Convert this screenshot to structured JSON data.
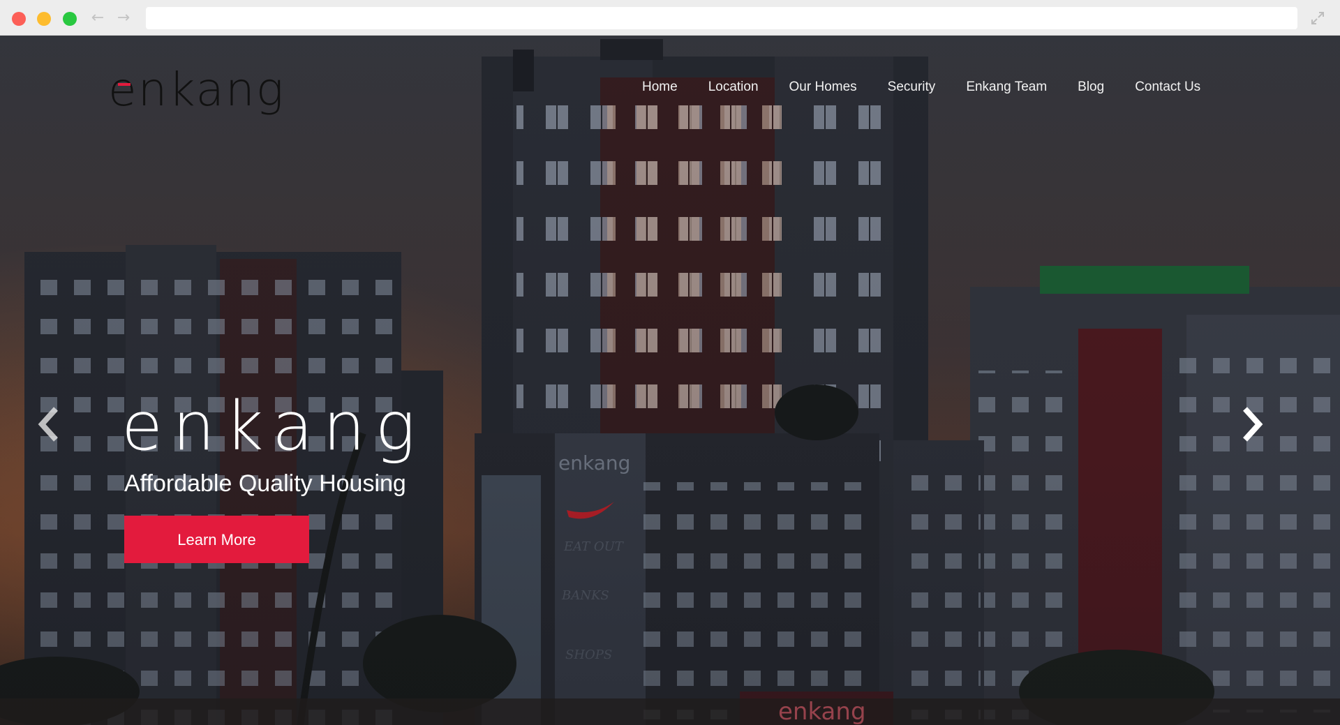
{
  "browser": {
    "controls": [
      "close",
      "minimize",
      "maximize"
    ],
    "back_icon": "←",
    "forward_icon": "→",
    "url": ""
  },
  "site": {
    "logo_text": "enkang",
    "nav": [
      {
        "label": "Home"
      },
      {
        "label": "Location"
      },
      {
        "label": "Our Homes"
      },
      {
        "label": "Security"
      },
      {
        "label": "Enkang Team"
      },
      {
        "label": "Blog"
      },
      {
        "label": "Contact Us"
      }
    ]
  },
  "hero": {
    "brand": "enkang",
    "tagline": "Affordable Quality Housing",
    "cta_label": "Learn More",
    "building_signs": [
      "enkang",
      "EAT OUT",
      "BANKS",
      "SHOPS",
      "enkang"
    ]
  },
  "colors": {
    "accent": "#e31b3d",
    "nav_text": "#f2f2f2",
    "chrome": "#ededed"
  }
}
